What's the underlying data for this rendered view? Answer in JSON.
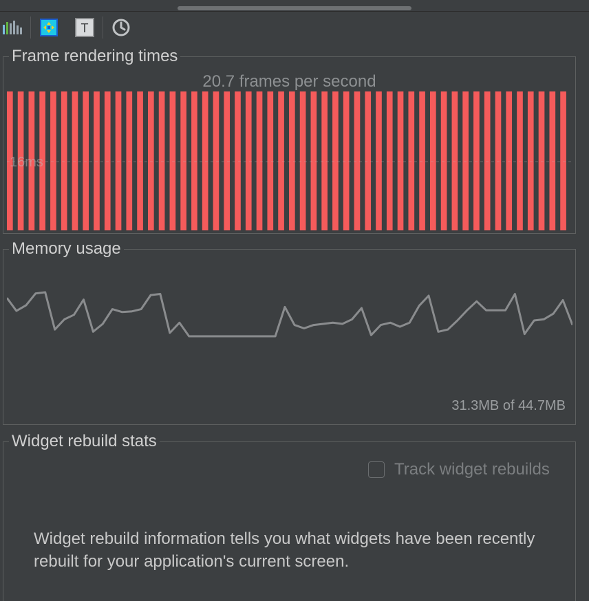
{
  "toolbar": {
    "buttons": [
      {
        "name": "performance-overlay-icon"
      },
      {
        "name": "debug-paint-icon"
      },
      {
        "name": "text-baseline-icon"
      },
      {
        "name": "slow-animations-clock-icon"
      }
    ]
  },
  "frames": {
    "title": "Frame rendering times",
    "fps": "20.7 frames per second",
    "threshold_label": "16ms",
    "bar_count": 52,
    "bar_level": 1.0,
    "bar_color": "#f55b5b"
  },
  "memory": {
    "title": "Memory usage",
    "usage": "31.3MB of 44.7MB",
    "line_color": "#8a8c8e",
    "samples": [
      0.68,
      0.45,
      0.55,
      0.76,
      0.78,
      0.12,
      0.3,
      0.38,
      0.65,
      0.08,
      0.22,
      0.48,
      0.43,
      0.44,
      0.48,
      0.73,
      0.75,
      0.06,
      0.24,
      0.0,
      0.0,
      0.0,
      0.0,
      0.0,
      0.0,
      0.0,
      0.0,
      0.0,
      0.0,
      0.52,
      0.2,
      0.14,
      0.2,
      0.22,
      0.24,
      0.22,
      0.3,
      0.5,
      0.02,
      0.2,
      0.24,
      0.17,
      0.24,
      0.54,
      0.72,
      0.08,
      0.12,
      0.28,
      0.46,
      0.62,
      0.46,
      0.46,
      0.46,
      0.75,
      0.04,
      0.28,
      0.3,
      0.4,
      0.64,
      0.2
    ]
  },
  "widget": {
    "title": "Widget rebuild stats",
    "track_label": "Track widget rebuilds",
    "track_checked": false,
    "info": "Widget rebuild information tells you what widgets have been recently rebuilt for your application's current screen."
  }
}
